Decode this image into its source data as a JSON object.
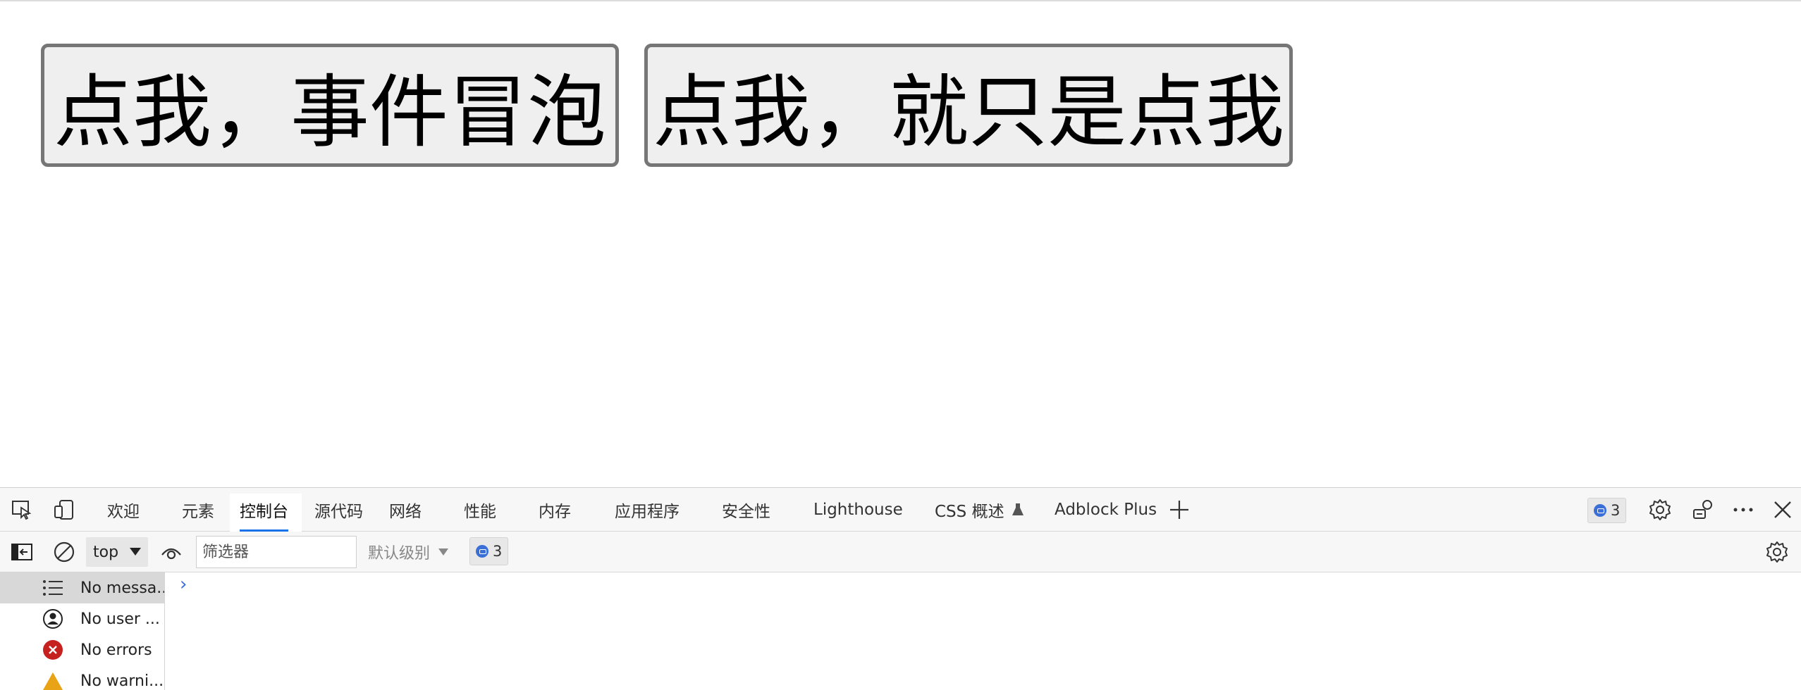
{
  "page": {
    "button_bubble": "点我，事件冒泡",
    "button_plain": "点我，就只是点我"
  },
  "devtools": {
    "tabs": [
      {
        "label": "欢迎"
      },
      {
        "label": "元素"
      },
      {
        "label": "控制台"
      },
      {
        "label": "源代码"
      },
      {
        "label": "网络"
      },
      {
        "label": "性能"
      },
      {
        "label": "内存"
      },
      {
        "label": "应用程序"
      },
      {
        "label": "安全性"
      },
      {
        "label": "Lighthouse"
      },
      {
        "label": "CSS 概述"
      },
      {
        "label": "Adblock Plus"
      }
    ],
    "active_tab": "控制台",
    "message_count": "3",
    "toolbar": {
      "context": "top",
      "filter_placeholder": "筛选器",
      "level": "默认级别",
      "message_count": "3"
    },
    "sidebar": {
      "items": [
        {
          "label": "No messa...",
          "icon": "list-icon"
        },
        {
          "label": "No user ...",
          "icon": "user-icon"
        },
        {
          "label": "No errors",
          "icon": "error-icon"
        },
        {
          "label": "No warni...",
          "icon": "warning-icon"
        }
      ]
    },
    "colors": {
      "accent": "#1a73e8",
      "error": "#c5221f",
      "warning": "#e8a317",
      "message": "#3b6fd8"
    }
  }
}
